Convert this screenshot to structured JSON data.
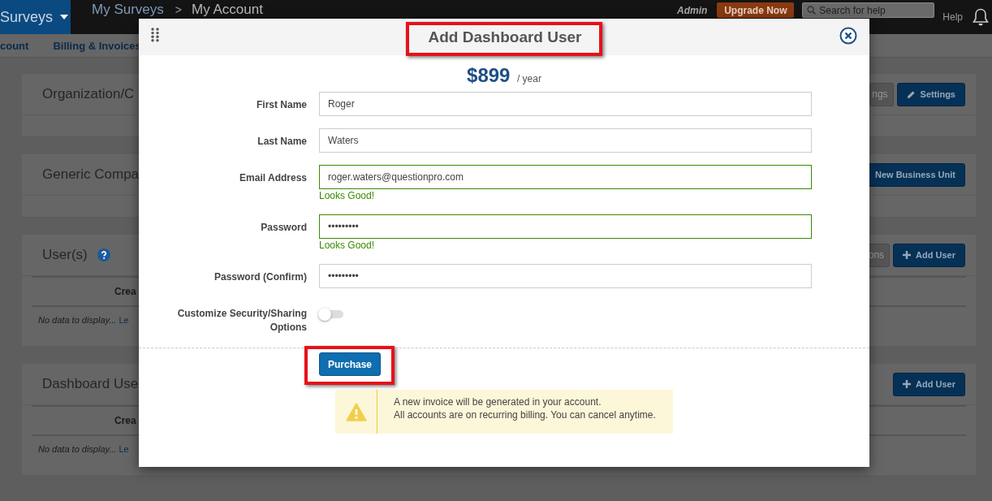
{
  "top_bar": {
    "brand": "Surveys",
    "breadcrumbs": [
      "My Surveys",
      "My Account"
    ],
    "separator": ">",
    "role": "Admin",
    "upgrade_button": "Upgrade Now",
    "search": {
      "placeholder": "Search for help"
    },
    "help": "Help"
  },
  "subnav": [
    "count",
    "Billing & Invoices"
  ],
  "cards": [
    {
      "title": "Organization/C",
      "buttons": [
        {
          "label": "ngs",
          "kind": "secondary"
        },
        {
          "label": "Settings",
          "kind": "edit"
        }
      ]
    },
    {
      "title": "Generic Compa",
      "buttons": [
        {
          "label": "New Business Unit",
          "kind": "primary"
        }
      ]
    },
    {
      "title": "User(s)",
      "help": true,
      "buttons": [
        {
          "label": "ons",
          "kind": "secondary"
        },
        {
          "label": "Add User",
          "kind": "add"
        }
      ],
      "table": {
        "column": "Crea",
        "empty_text": "No data to display...",
        "link": "Le"
      }
    },
    {
      "title": "Dashboard Use",
      "buttons": [
        {
          "label": "Add User",
          "kind": "add"
        }
      ],
      "table": {
        "column": "Crea",
        "empty_text": "No data to display...",
        "link": "Le"
      }
    }
  ],
  "dialog": {
    "title": "Add Dashboard User",
    "price": "$899",
    "period": "/ year",
    "fields": [
      {
        "kind": "text",
        "label": "First Name",
        "value": "Roger",
        "valid": false
      },
      {
        "kind": "text",
        "label": "Last Name",
        "value": "Waters",
        "valid": false
      },
      {
        "kind": "text",
        "label": "Email Address",
        "value": "roger.waters@questionpro.com",
        "valid": true,
        "message": "Looks Good!"
      },
      {
        "kind": "text",
        "label": "Password",
        "value": "•••••••••",
        "valid": true,
        "message": "Looks Good!"
      },
      {
        "kind": "text",
        "label": "Password (Confirm)",
        "value": "•••••••••",
        "valid": false
      },
      {
        "kind": "toggle",
        "label": "Customize Security/Sharing Options",
        "on": false
      }
    ],
    "purchase_button": "Purchase",
    "notice": [
      "A new invoice will be generated in your account.",
      "All accounts are on recurring billing. You can cancel anytime."
    ]
  }
}
